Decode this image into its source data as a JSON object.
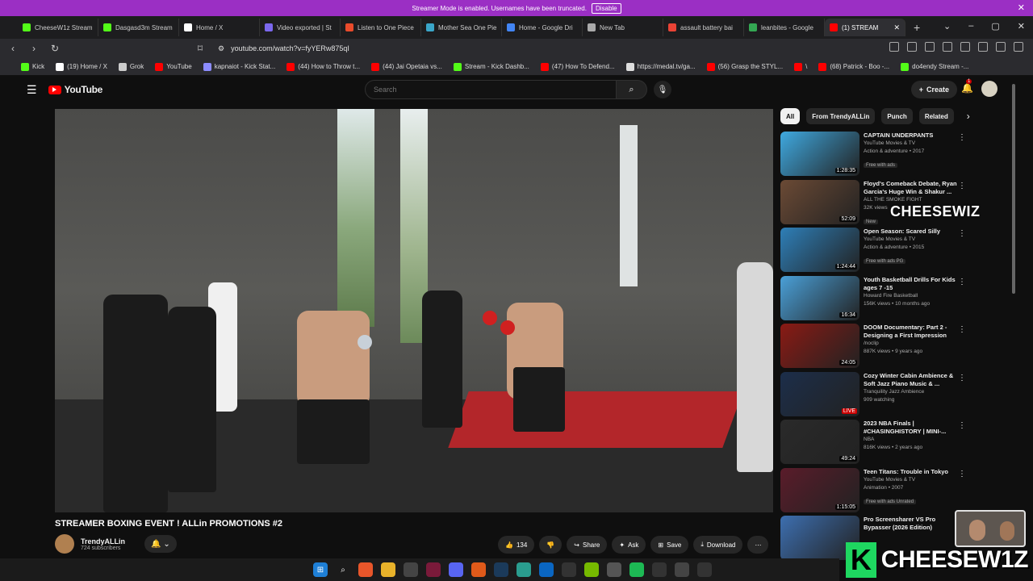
{
  "banner": {
    "message": "Streamer Mode is enabled. Usernames have been truncated.",
    "button": "Disable"
  },
  "tabs": [
    {
      "label": "CheeseW1z Stream",
      "color": "#53fc18"
    },
    {
      "label": "Dasgasd3m Stream",
      "color": "#53fc18"
    },
    {
      "label": "Home / X",
      "color": "#ffffff"
    },
    {
      "label": "Video exported | St",
      "color": "#7b68ee"
    },
    {
      "label": "Listen to One Piece",
      "color": "#e94b2b"
    },
    {
      "label": "Mother Sea One Pie",
      "color": "#3aa6c9"
    },
    {
      "label": "Home - Google Dri",
      "color": "#4285f4"
    },
    {
      "label": "New Tab",
      "color": "#aaaaaa"
    },
    {
      "label": "assault battery bai",
      "color": "#ea4335"
    },
    {
      "label": "leanbites - Google",
      "color": "#34a853"
    },
    {
      "label": "(1) STREAM",
      "color": "#ff0000"
    }
  ],
  "nav": {
    "url": "youtube.com/watch?v=fyYERw875qI"
  },
  "bookmarks": [
    "Kick",
    "(19) Home / X",
    "Grok",
    "YouTube",
    "kapnaiot - Kick Stat...",
    "(44) How to Throw t...",
    "(44) Jai Opetaia vs...",
    "Stream - Kick Dashb...",
    "(47) How To Defend...",
    "https://medal.tv/ga...",
    "(56) Grasp the STYL...",
    "\\",
    "(68) Patrick - Boo -...",
    "do4endy Stream -..."
  ],
  "yt": {
    "logo": "YouTube",
    "search_placeholder": "Search",
    "create": "Create",
    "notif_count": "1"
  },
  "video": {
    "title": "STREAMER BOXING EVENT ! ALLin PROMOTIONS #2",
    "channel": "TrendyALLin",
    "subscribers": "724 subscribers",
    "likes": "134",
    "share": "Share",
    "ask": "Ask",
    "save": "Save",
    "download": "Download"
  },
  "chips": [
    "All",
    "From TrendyALLin",
    "Punch",
    "Related"
  ],
  "recs": [
    {
      "title": "CAPTAIN UNDERPANTS",
      "channel": "YouTube Movies & TV",
      "meta": "Action & adventure • 2017",
      "tag": "Free with ads",
      "duration": "1:28:35",
      "color": "#3fa9e0",
      "live": false
    },
    {
      "title": "Floyd's Comeback Debate, Ryan Garcia's Huge Win & Shakur ...",
      "channel": "ALL THE SMOKE FIGHT",
      "meta": "32K views",
      "tag": "New",
      "duration": "52:09",
      "color": "#6b4a35",
      "live": false
    },
    {
      "title": "Open Season: Scared Silly",
      "channel": "YouTube Movies & TV",
      "meta": "Action & adventure • 2015",
      "tag": "Free with ads  PG",
      "duration": "1:24:44",
      "color": "#2e7fb8",
      "live": false
    },
    {
      "title": "Youth Basketball Drills For Kids ages 7 -15",
      "channel": "Howard Fire Basketball",
      "meta": "156K views • 10 months ago",
      "tag": "",
      "duration": "16:34",
      "color": "#4aa0d8",
      "live": false
    },
    {
      "title": "DOOM Documentary: Part 2 - Designing a First Impression",
      "channel": "/noclip",
      "meta": "887K views • 9 years ago",
      "tag": "",
      "duration": "24:05",
      "color": "#8a1a14",
      "live": false
    },
    {
      "title": "Cozy Winter Cabin Ambience & Soft Jazz Piano Music & ...",
      "channel": "Tranquility Jazz Ambience",
      "meta": "909 watching",
      "tag": "",
      "duration": "LIVE",
      "color": "#1c2e4a",
      "live": true
    },
    {
      "title": "2023 NBA Finals | #CHASINGHISTORY | MINI-...",
      "channel": "NBA",
      "meta": "816K views • 2 years ago",
      "tag": "",
      "duration": "49:24",
      "color": "#2a2a2a",
      "live": false
    },
    {
      "title": "Teen Titans: Trouble in Tokyo",
      "channel": "YouTube Movies & TV",
      "meta": "Animation • 2007",
      "tag": "Free with ads  Unrated",
      "duration": "1:15:05",
      "color": "#5a1c2a",
      "live": false
    },
    {
      "title": "Pro Screensharer VS Pro Bypasser (2026 Edition)",
      "channel": "",
      "meta": "",
      "tag": "",
      "duration": "",
      "color": "#3d6fb0",
      "live": false
    }
  ],
  "overlay": {
    "name": "CHEESEWIZ",
    "brand_k": "K",
    "brand_text": "CHEESEW1Z"
  }
}
